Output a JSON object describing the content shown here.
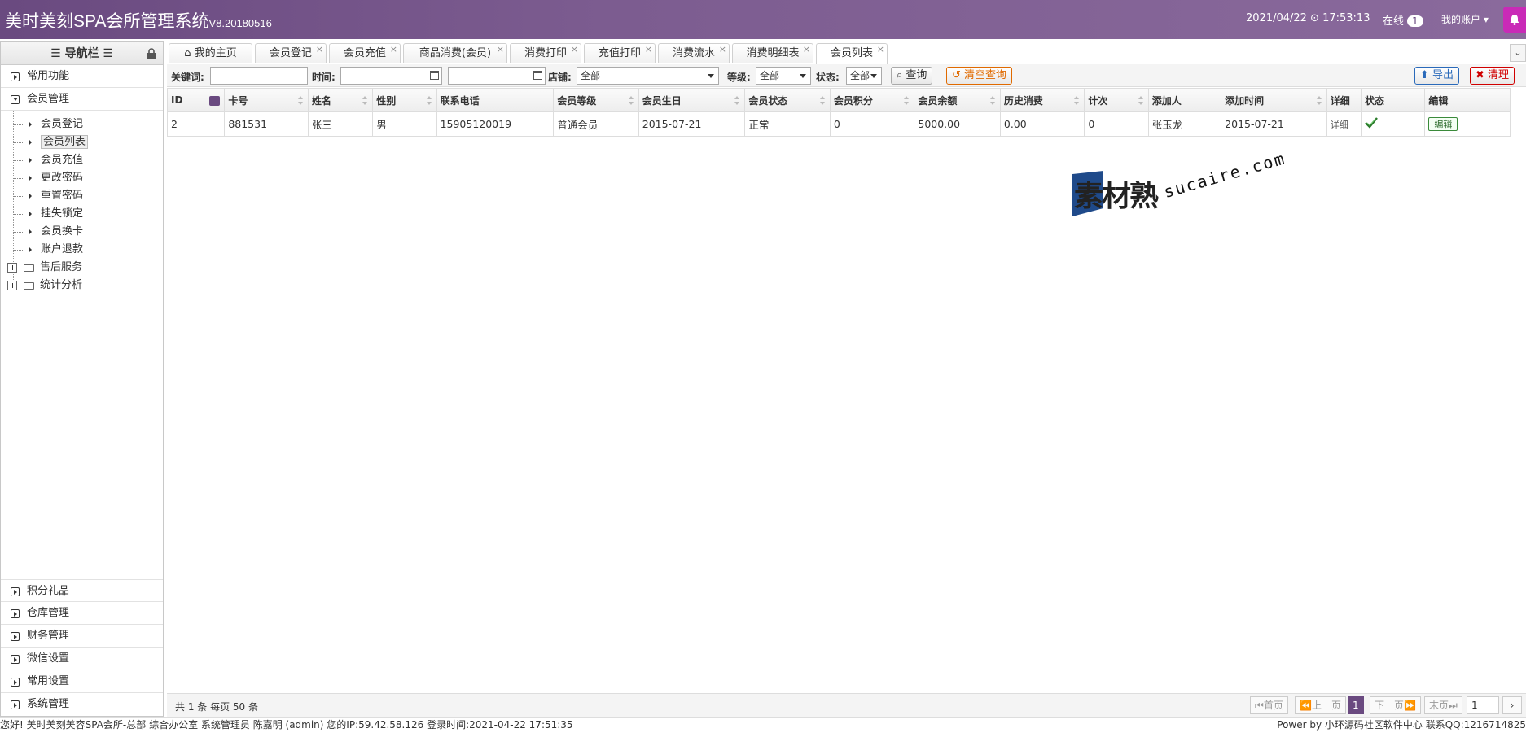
{
  "header": {
    "title": "美时美刻SPA会所管理系统",
    "version": "V8.20180516",
    "datetime": "2021/04/22 ⊙ 17:53:13",
    "online_label": "在线",
    "online_count": "1",
    "account_label": "我的账户"
  },
  "sidebar": {
    "title": "☰ 导航栏 ☰",
    "top_groups": [
      {
        "label": "常用功能"
      },
      {
        "label": "会员管理"
      }
    ],
    "member_items": [
      "会员登记",
      "会员列表",
      "会员充值",
      "更改密码",
      "重置密码",
      "挂失锁定",
      "会员换卡",
      "账户退款"
    ],
    "tree_groups": [
      "售后服务",
      "统计分析"
    ],
    "bottom_groups": [
      "积分礼品",
      "仓库管理",
      "财务管理",
      "微信设置",
      "常用设置",
      "系统管理"
    ]
  },
  "tabs": [
    {
      "label": "我的主页"
    },
    {
      "label": "会员登记"
    },
    {
      "label": "会员充值"
    },
    {
      "label": "商品消费(会员)"
    },
    {
      "label": "消费打印"
    },
    {
      "label": "充值打印"
    },
    {
      "label": "消费流水"
    },
    {
      "label": "消费明细表"
    },
    {
      "label": "会员列表"
    }
  ],
  "toolbar": {
    "keyword_label": "关键词:",
    "time_label": "时间:",
    "dash": "-",
    "shop_label": "店铺:",
    "shop_value": "全部",
    "level_label": "等级:",
    "level_value": "全部",
    "status_label": "状态:",
    "status_value": "全部",
    "query_btn": "查询",
    "clear_btn": "清空查询",
    "export_btn": "导出",
    "cleanup_btn": "清理"
  },
  "table": {
    "columns": [
      "ID",
      "卡号",
      "姓名",
      "性别",
      "联系电话",
      "会员等级",
      "会员生日",
      "会员状态",
      "会员积分",
      "会员余额",
      "历史消费",
      "计次",
      "添加人",
      "添加时间",
      "详细",
      "状态",
      "编辑"
    ],
    "rows": [
      [
        "2",
        "881531",
        "张三",
        "男",
        "15905120019",
        "普通会员",
        "2015-07-21",
        "正常",
        "0",
        "5000.00",
        "0.00",
        "0",
        "张玉龙",
        "2015-07-21",
        "详细",
        "",
        "编辑"
      ]
    ]
  },
  "pager": {
    "summary": "共 1 条 每页 50 条",
    "first": "首页",
    "prev": "上一页",
    "current": "1",
    "next": "下一页",
    "last": "末页",
    "page_input": "1"
  },
  "watermark": {
    "cn": "素材熟",
    "en": "sucaire.com"
  },
  "status": {
    "left": "您好! 美时美刻美容SPA会所-总部 综合办公室 系统管理员 陈嘉明 (admin) 您的IP:59.42.58.126 登录时间:2021-04-22 17:51:35",
    "right": "Power by 小环源码社区软件中心 联系QQ:1216714825"
  },
  "colors": {
    "header_bg": "#7c5c90",
    "bell_bg": "#c92ab7",
    "accent_purple": "#6a4a80",
    "clear_orange": "#e06a00",
    "cleanup_red": "#d00000",
    "export_blue": "#2a6aba"
  }
}
